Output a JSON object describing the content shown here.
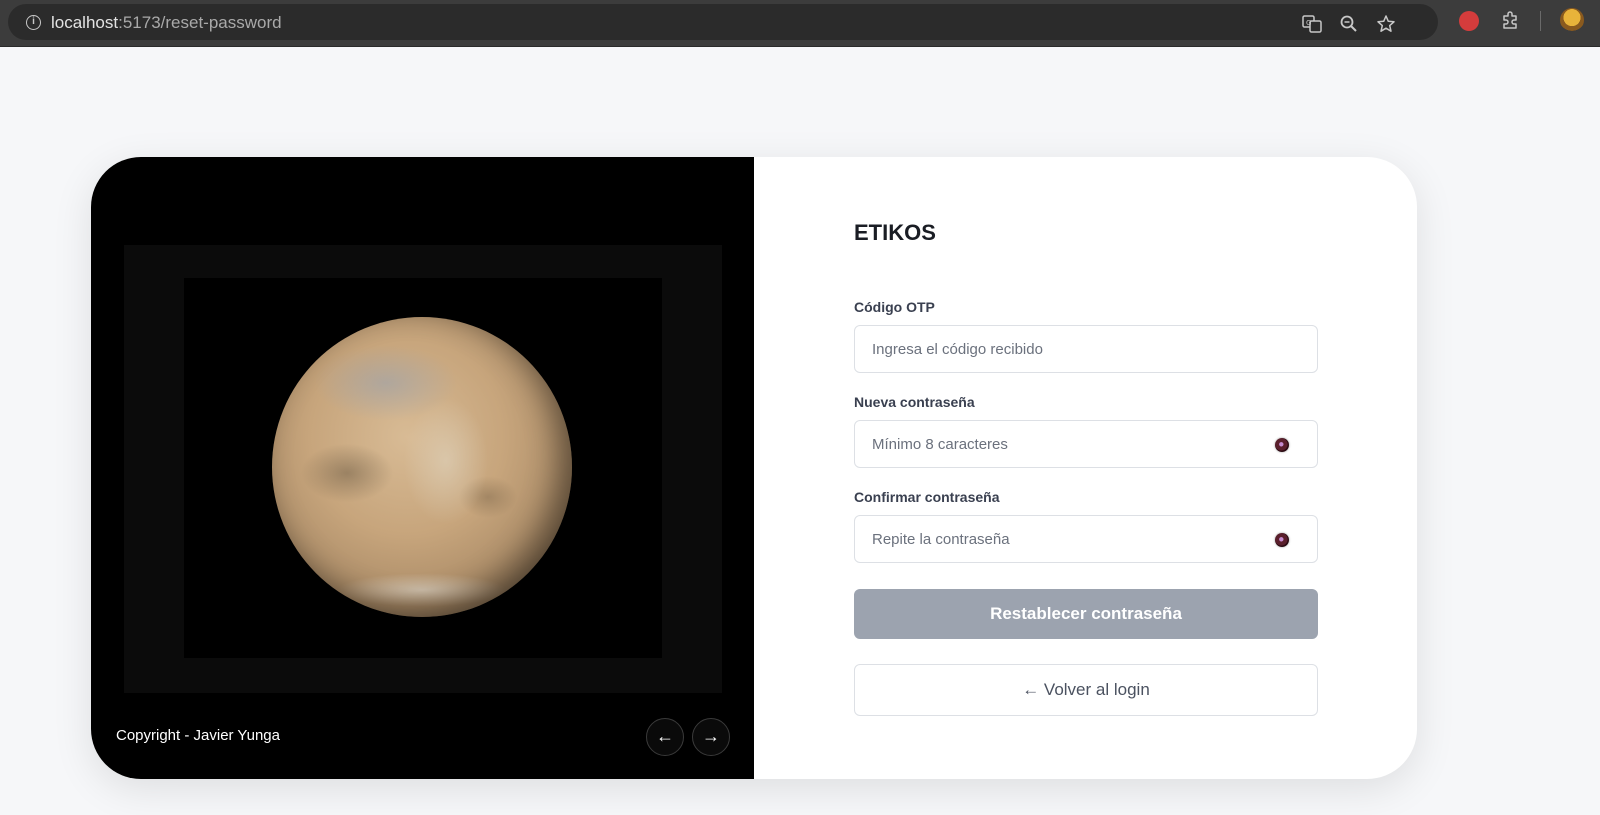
{
  "browser": {
    "url_host": "localhost",
    "url_path": ":5173/reset-password"
  },
  "hero": {
    "copyright": "Copyright - Javier Yunga",
    "prev_label": "←",
    "next_label": "→"
  },
  "form": {
    "brand": "ETIKOS",
    "otp_label": "Código OTP",
    "otp_placeholder": "Ingresa el código recibido",
    "new_password_label": "Nueva contraseña",
    "new_password_placeholder": "Mínimo 8 caracteres",
    "confirm_password_label": "Confirmar contraseña",
    "confirm_password_placeholder": "Repite la contraseña",
    "submit_label": "Restablecer contraseña",
    "back_label": "← Volver al login"
  },
  "colors": {
    "submit_disabled": "#9ca3af",
    "hero_bg": "#000000",
    "page_bg": "#f6f7f9"
  },
  "icons": [
    "info-icon",
    "translate-icon",
    "zoom-icon",
    "star-icon",
    "extension-icon",
    "puzzle-icon",
    "eye-icon"
  ]
}
